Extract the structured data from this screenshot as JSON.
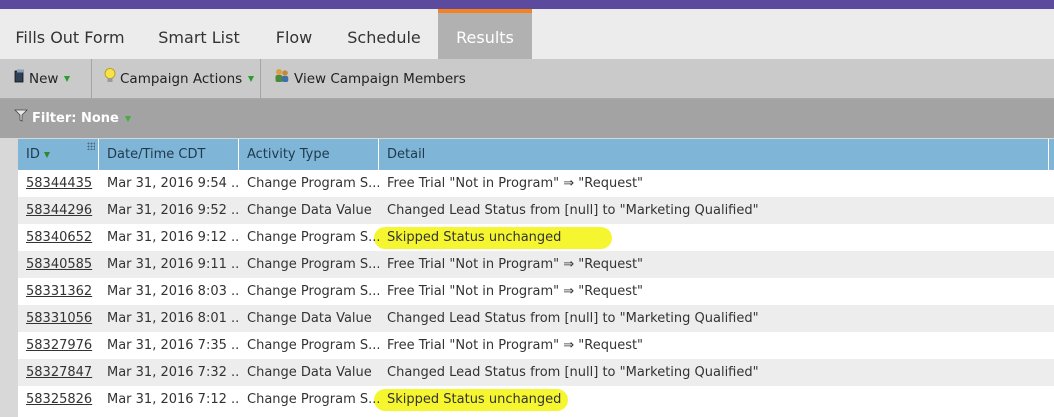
{
  "tabs": [
    {
      "label": "Fills Out Form"
    },
    {
      "label": "Smart List"
    },
    {
      "label": "Flow"
    },
    {
      "label": "Schedule"
    },
    {
      "label": "Results",
      "active": true
    }
  ],
  "toolbar": {
    "new_label": "New",
    "campaign_actions_label": "Campaign Actions",
    "view_members_label": "View Campaign Members"
  },
  "filter": {
    "label": "Filter: None"
  },
  "grid": {
    "columns": [
      "ID",
      "Date/Time CDT",
      "Activity Type",
      "Detail"
    ],
    "rows": [
      {
        "id": "58344435",
        "datetime": "Mar 31, 2016 9:54 ...",
        "activity": "Change Program S...",
        "detail": "Free Trial \"Not in Program\" ⇒ \"Request\"",
        "highlighted": false
      },
      {
        "id": "58344296",
        "datetime": "Mar 31, 2016 9:52 ...",
        "activity": "Change Data Value",
        "detail": "Changed Lead Status from [null] to \"Marketing Qualified\"",
        "highlighted": false
      },
      {
        "id": "58340652",
        "datetime": "Mar 31, 2016 9:12 ...",
        "activity": "Change Program S...",
        "detail": "Skipped Status unchanged",
        "highlighted": true
      },
      {
        "id": "58340585",
        "datetime": "Mar 31, 2016 9:11 ...",
        "activity": "Change Program S...",
        "detail": "Free Trial \"Not in Program\" ⇒ \"Request\"",
        "highlighted": false
      },
      {
        "id": "58331362",
        "datetime": "Mar 31, 2016 8:03 ...",
        "activity": "Change Program S...",
        "detail": "Free Trial \"Not in Program\" ⇒ \"Request\"",
        "highlighted": false
      },
      {
        "id": "58331056",
        "datetime": "Mar 31, 2016 8:01 ...",
        "activity": "Change Data Value",
        "detail": "Changed Lead Status from [null] to \"Marketing Qualified\"",
        "highlighted": false
      },
      {
        "id": "58327976",
        "datetime": "Mar 31, 2016 7:35 ...",
        "activity": "Change Program S...",
        "detail": "Free Trial \"Not in Program\" ⇒ \"Request\"",
        "highlighted": false
      },
      {
        "id": "58327847",
        "datetime": "Mar 31, 2016 7:32 ...",
        "activity": "Change Data Value",
        "detail": "Changed Lead Status from [null] to \"Marketing Qualified\"",
        "highlighted": false
      },
      {
        "id": "58325826",
        "datetime": "Mar 31, 2016 7:12 ...",
        "activity": "Change Program S...",
        "detail": "Skipped Status unchanged",
        "highlighted": true
      }
    ]
  },
  "colors": {
    "topbar": "#5b4a9e",
    "active_tab_accent": "#f58220",
    "grid_header": "#7fb5d6",
    "highlight": "#f5f519"
  }
}
